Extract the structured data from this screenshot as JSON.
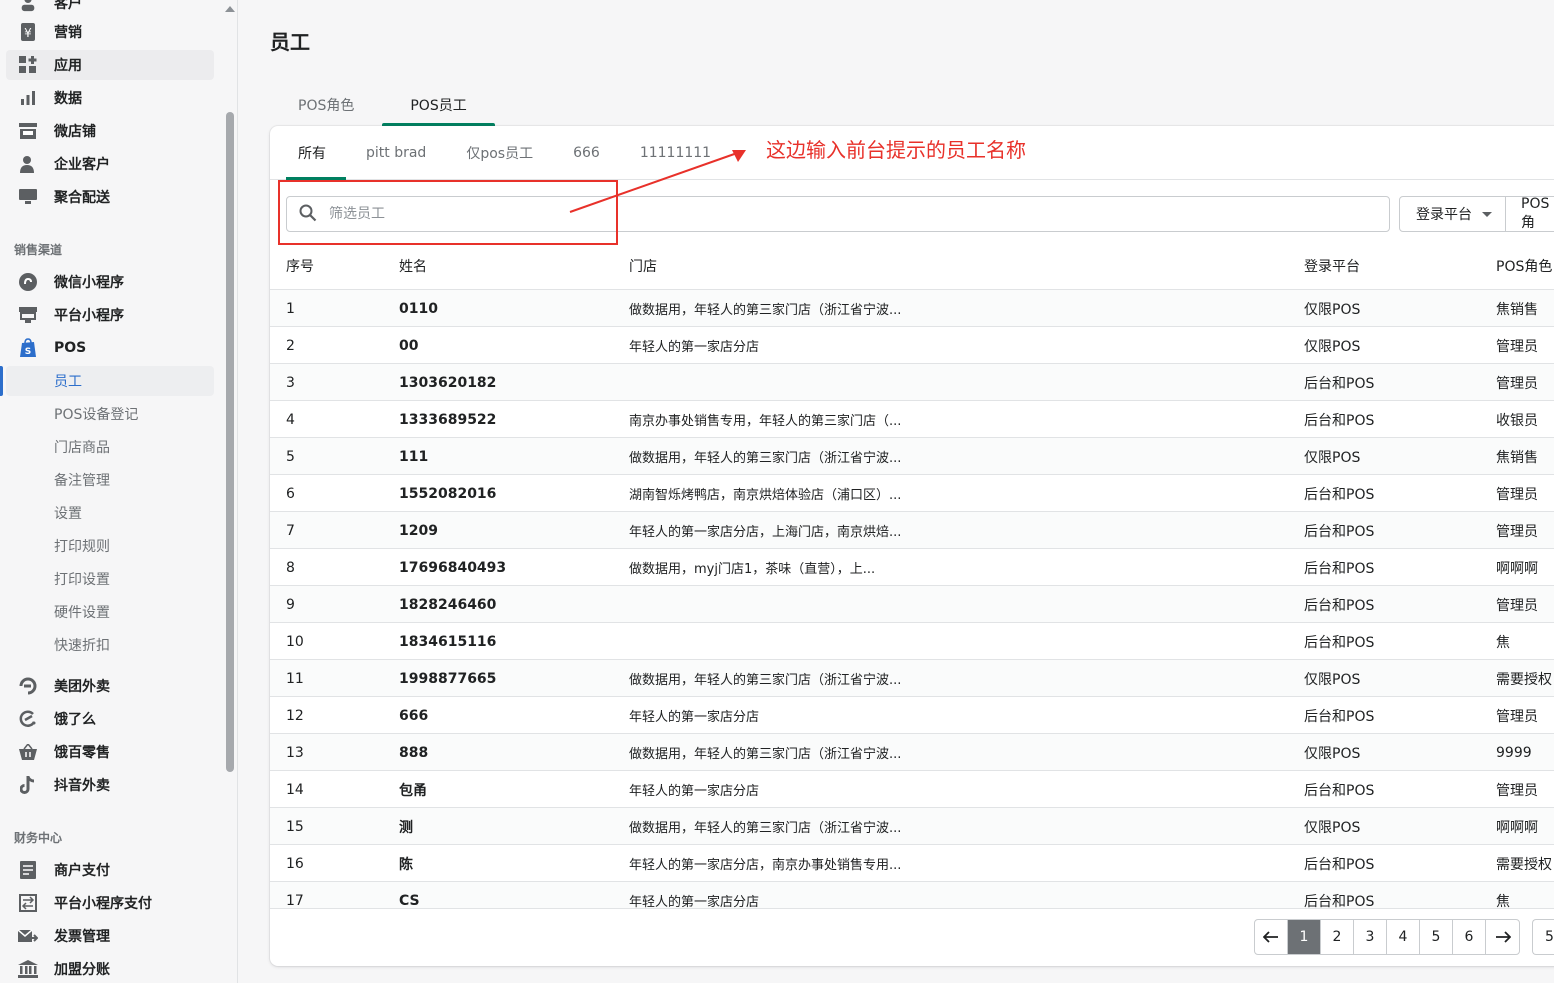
{
  "sidebar": {
    "top_partial": "客户",
    "items": [
      {
        "label": "营销",
        "icon": "yen-tag-icon"
      },
      {
        "label": "应用",
        "icon": "apps-icon"
      },
      {
        "label": "数据",
        "icon": "bar-chart-icon"
      },
      {
        "label": "微店铺",
        "icon": "store-icon"
      },
      {
        "label": "企业客户",
        "icon": "user-icon"
      },
      {
        "label": "聚合配送",
        "icon": "monitor-icon"
      }
    ],
    "sales_section": "销售渠道",
    "sales_items": [
      {
        "label": "微信小程序",
        "icon": "wechat-icon"
      },
      {
        "label": "平台小程序",
        "icon": "platform-store-icon"
      },
      {
        "label": "POS",
        "icon": "shopify-bag-icon"
      }
    ],
    "pos_sub": [
      "员工",
      "POS设备登记",
      "门店商品",
      "备注管理",
      "设置",
      "打印规则",
      "打印设置",
      "硬件设置",
      "快速折扣"
    ],
    "delivery_items": [
      {
        "label": "美团外卖",
        "icon": "meituan-icon"
      },
      {
        "label": "饿了么",
        "icon": "eleme-icon"
      },
      {
        "label": "饿百零售",
        "icon": "basket-icon"
      },
      {
        "label": "抖音外卖",
        "icon": "tiktok-icon"
      }
    ],
    "finance_section": "财务中心",
    "finance_items": [
      {
        "label": "商户支付",
        "icon": "document-icon"
      },
      {
        "label": "平台小程序支付",
        "icon": "transfer-icon"
      },
      {
        "label": "发票管理",
        "icon": "invoice-icon"
      },
      {
        "label": "加盟分账",
        "icon": "bank-icon"
      }
    ]
  },
  "page": {
    "title": "员工",
    "top_tabs": [
      "POS角色",
      "POS员工"
    ],
    "filter_tabs": [
      "所有",
      "pitt brad",
      "仅pos员工",
      "666",
      "11111111"
    ],
    "search_placeholder": "筛选员工",
    "dropdown_platform": "登录平台",
    "dropdown_role": "POS角",
    "columns": [
      "序号",
      "姓名",
      "门店",
      "登录平台",
      "POS角色"
    ]
  },
  "rows": [
    {
      "no": "1",
      "name": "0110",
      "store": "做数据用，年轻人的第三家门店（浙江省宁波...",
      "platform": "仅限POS",
      "role": "焦销售"
    },
    {
      "no": "2",
      "name": "00",
      "store": "年轻人的第一家店分店",
      "platform": "仅限POS",
      "role": "管理员"
    },
    {
      "no": "3",
      "name": "1303620182",
      "store": "",
      "platform": "后台和POS",
      "role": "管理员"
    },
    {
      "no": "4",
      "name": "1333689522",
      "store": "南京办事处销售专用，年轻人的第三家门店（...",
      "platform": "后台和POS",
      "role": "收银员"
    },
    {
      "no": "5",
      "name": "111",
      "store": "做数据用，年轻人的第三家门店（浙江省宁波...",
      "platform": "仅限POS",
      "role": "焦销售"
    },
    {
      "no": "6",
      "name": "1552082016",
      "store": "湖南智烁烤鸭店，南京烘焙体验店（浦口区）...",
      "platform": "后台和POS",
      "role": "管理员"
    },
    {
      "no": "7",
      "name": "1209",
      "store": "年轻人的第一家店分店，上海门店，南京烘焙...",
      "platform": "后台和POS",
      "role": "管理员"
    },
    {
      "no": "8",
      "name": "17696840493",
      "store": "做数据用，myj门店1，茶味（直营），上...",
      "platform": "后台和POS",
      "role": "啊啊啊"
    },
    {
      "no": "9",
      "name": "1828246460",
      "store": "",
      "platform": "后台和POS",
      "role": "管理员"
    },
    {
      "no": "10",
      "name": "1834615116",
      "store": "",
      "platform": "后台和POS",
      "role": "焦"
    },
    {
      "no": "11",
      "name": "1998877665",
      "store": "做数据用，年轻人的第三家门店（浙江省宁波...",
      "platform": "仅限POS",
      "role": "需要授权"
    },
    {
      "no": "12",
      "name": "666",
      "store": "年轻人的第一家店分店",
      "platform": "后台和POS",
      "role": "管理员"
    },
    {
      "no": "13",
      "name": "888",
      "store": "做数据用，年轻人的第三家门店（浙江省宁波...",
      "platform": "仅限POS",
      "role": "9999"
    },
    {
      "no": "14",
      "name": "包甬",
      "store": "年轻人的第一家店分店",
      "platform": "后台和POS",
      "role": "管理员"
    },
    {
      "no": "15",
      "name": "测",
      "store": "做数据用，年轻人的第三家门店（浙江省宁波...",
      "platform": "仅限POS",
      "role": "啊啊啊"
    },
    {
      "no": "16",
      "name": "陈",
      "store": "年轻人的第一家店分店，南京办事处销售专用...",
      "platform": "后台和POS",
      "role": "需要授权"
    },
    {
      "no": "17",
      "name": "CS",
      "store": "年轻人的第一家店分店",
      "platform": "后台和POS",
      "role": "焦"
    }
  ],
  "pagination": {
    "pages": [
      "1",
      "2",
      "3",
      "4",
      "5",
      "6"
    ],
    "current": "1",
    "last_partial": "5"
  },
  "annotation": {
    "text": "这边输入前台提示的员工名称",
    "color": "#e8312a"
  },
  "colors": {
    "accent": "#008060",
    "link": "#2c6ecb",
    "annotation": "#e8312a"
  }
}
